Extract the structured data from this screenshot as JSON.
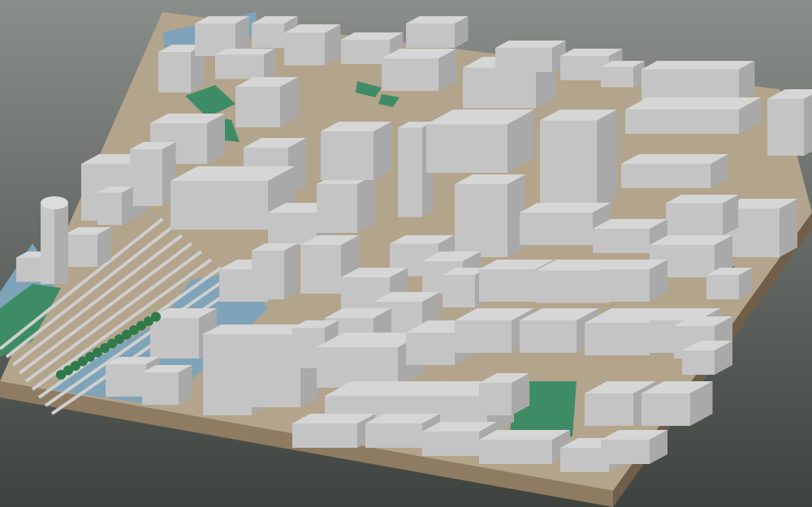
{
  "viewport": {
    "title": "",
    "background_colors": [
      "#8a8e8a",
      "#3f433f"
    ]
  },
  "model": {
    "type": "3d-city-block-model",
    "view": "isometric-oblique",
    "colors": {
      "base_top": "#b3a48c",
      "base_side_front": "#8e7c62",
      "base_side_right": "#6f5f4a",
      "building_top": "#d6d6d6",
      "building_left": "#c4c4c4",
      "building_right": "#a9a9a9",
      "park": "#3e8c66",
      "water": "#7fa3b8",
      "railway": "#cfcfcf",
      "trees": "#2e7a4a"
    },
    "features": [
      {
        "kind": "railway-tracks",
        "name": "rail-yard"
      },
      {
        "kind": "water",
        "name": "canal"
      },
      {
        "kind": "park",
        "name": "green-squares"
      },
      {
        "kind": "sports-field",
        "name": "football-pitch"
      },
      {
        "kind": "tower",
        "name": "cylindrical-tower"
      },
      {
        "kind": "trees",
        "name": "tree-row"
      }
    ]
  }
}
